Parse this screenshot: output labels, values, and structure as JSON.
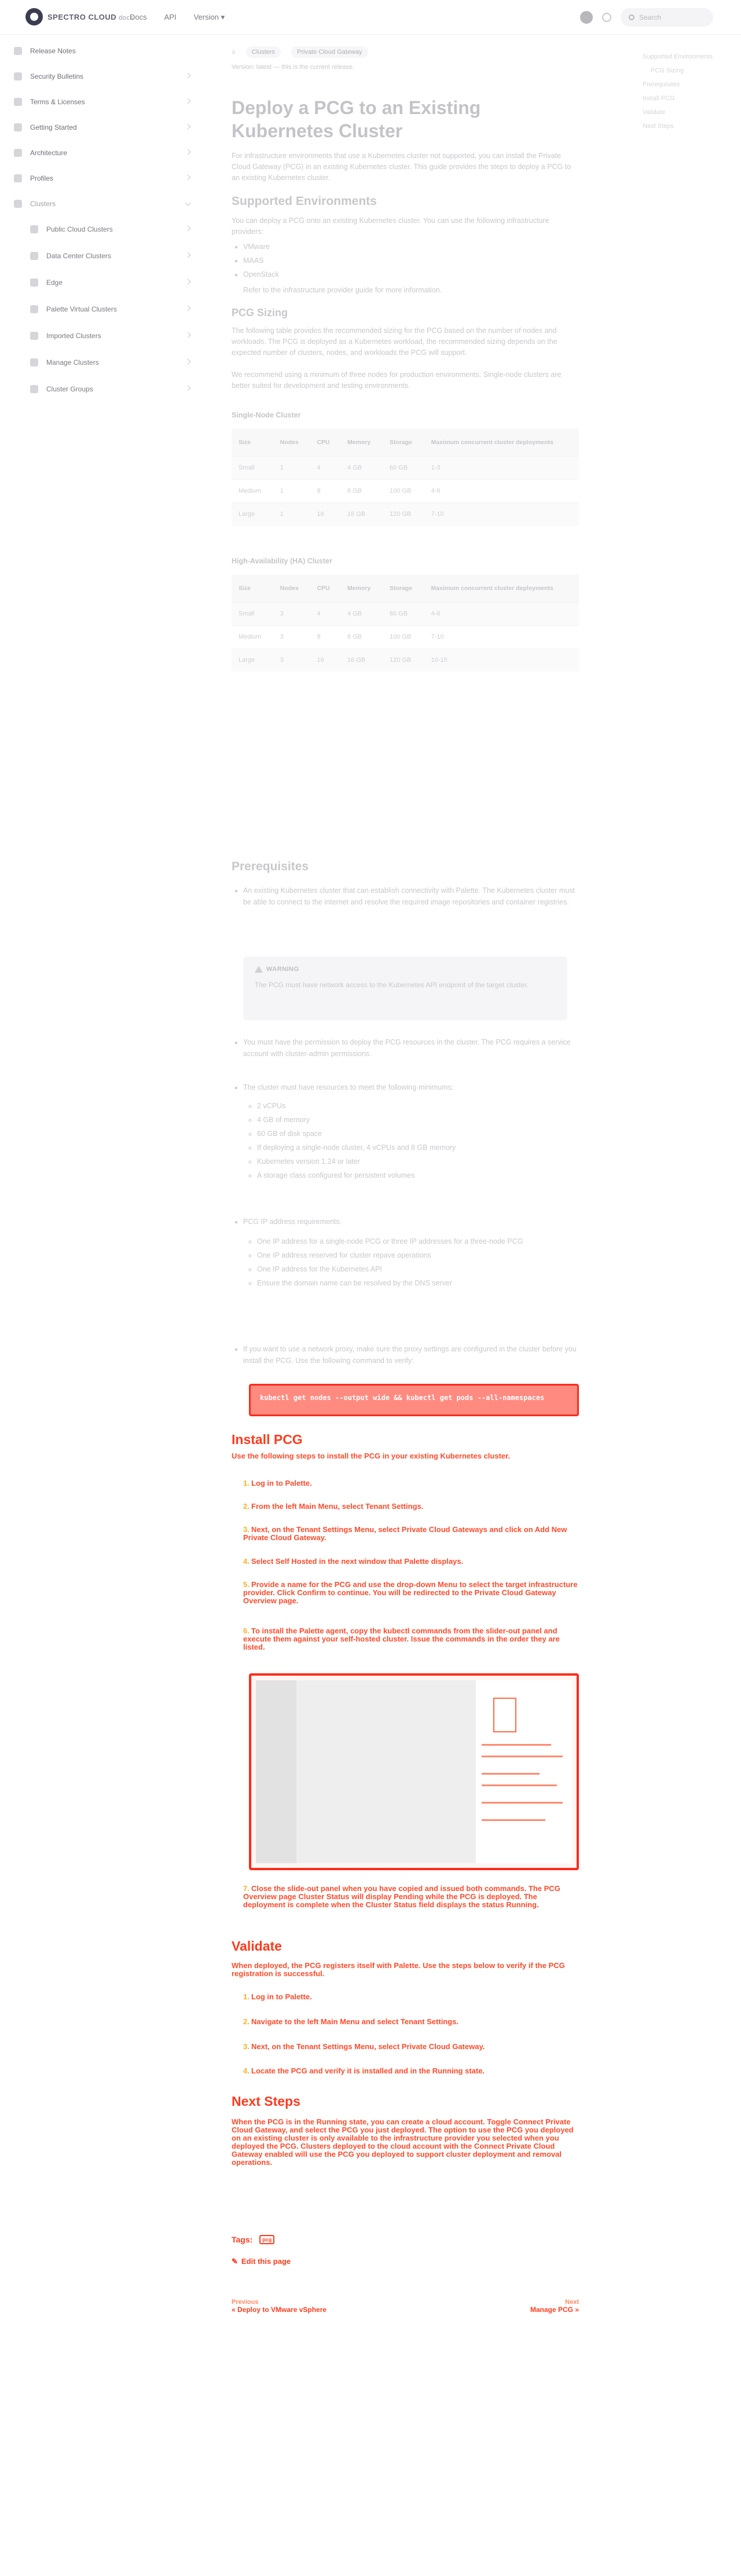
{
  "navbar": {
    "brand": "SPECTRO CLOUD",
    "brand_sub": "docs",
    "links": [
      "Docs",
      "API",
      "Version ▾"
    ],
    "search_placeholder": "Search"
  },
  "sidebar": {
    "items": [
      {
        "label": "Release Notes"
      },
      {
        "label": "Security Bulletins"
      },
      {
        "label": "Terms & Licenses"
      },
      {
        "label": "Getting Started"
      },
      {
        "label": "Architecture"
      },
      {
        "label": "Profiles"
      },
      {
        "label": "Clusters"
      },
      {
        "label": "Public Cloud Clusters"
      },
      {
        "label": "Data Center Clusters"
      },
      {
        "label": "Edge"
      },
      {
        "label": "Palette Virtual Clusters"
      },
      {
        "label": "Imported Clusters"
      },
      {
        "label": "Manage Clusters"
      },
      {
        "label": "Cluster Groups"
      }
    ]
  },
  "breadcrumb": [
    "Clusters",
    "Private Cloud Gateway"
  ],
  "page": {
    "version_note": "Version: latest — this is the current release.",
    "title": "Deploy a PCG to an Existing Kubernetes Cluster",
    "intro": "For infrastructure environments that use a Kubernetes cluster not supported, you can install the Private Cloud Gateway (PCG) in an existing Kubernetes cluster. This guide provides the steps to deploy a PCG to an existing Kubernetes cluster.",
    "supported_title": "Supported Environments",
    "supported_text": "You can deploy a PCG onto an existing Kubernetes cluster. You can use the following infrastructure providers:",
    "supported_items": [
      "VMware",
      "MAAS",
      "OpenStack"
    ],
    "supported_note": "Refer to the infrastructure provider guide for more information.",
    "sizing_title": "PCG Sizing",
    "sizing_text": "The following table provides the recommended sizing for the PCG based on the number of nodes and workloads. The PCG is deployed as a Kubernetes workload, the recommended sizing depends on the expected number of clusters, nodes, and workloads the PCG will support.",
    "sizing_text2": "We recommend using a minimum of three nodes for production environments. Single-node clusters are better suited for development and testing environments.",
    "single_title": "Single-Node Cluster",
    "ha_title": "High-Availability (HA) Cluster",
    "table_headers": [
      "Size",
      "Nodes",
      "CPU",
      "Memory",
      "Storage",
      "Maximum concurrent cluster deployments"
    ],
    "single_rows": [
      [
        "Small",
        "1",
        "4",
        "4 GB",
        "60 GB",
        "1-3"
      ],
      [
        "Medium",
        "1",
        "8",
        "8 GB",
        "100 GB",
        "4-6"
      ],
      [
        "Large",
        "1",
        "16",
        "16 GB",
        "120 GB",
        "7-10"
      ]
    ],
    "ha_rows": [
      [
        "Small",
        "3",
        "4",
        "4 GB",
        "60 GB",
        "4-6"
      ],
      [
        "Medium",
        "3",
        "8",
        "8 GB",
        "100 GB",
        "7-10"
      ],
      [
        "Large",
        "3",
        "16",
        "16 GB",
        "120 GB",
        "10-15"
      ]
    ],
    "prereq_title": "Prerequisites",
    "prereq_1": "An existing Kubernetes cluster that can establish connectivity with Palette. The Kubernetes cluster must be able to connect to the internet and resolve the required image repositories and container registries.",
    "warning_label": "WARNING",
    "warning_text": "The PCG must have network access to the Kubernetes API endpoint of the target cluster.",
    "prereq_2": "You must have the permission to deploy the PCG resources in the cluster. The PCG requires a service account with cluster-admin permissions.",
    "prereq_3": "The cluster must have resources to meet the following minimums:",
    "prereq_3_items": [
      "2 vCPUs",
      "4 GB of memory",
      "60 GB of disk space",
      "If deploying a single-node cluster, 4 vCPUs and 8 GB memory",
      "Kubernetes version 1.24 or later",
      "A storage class configured for persistent volumes"
    ],
    "prereq_4": "PCG IP address requirements:",
    "prereq_4_items": [
      "One IP address for a single-node PCG or three IP addresses for a three-node PCG",
      "One IP address reserved for cluster repave operations",
      "One IP address for the Kubernetes API",
      "Ensure the domain name can be resolved by the DNS server"
    ],
    "prereq_5": "If you want to use a network proxy, make sure the proxy settings are configured in the cluster before you install the PCG. Use the following command to verify:",
    "code": "kubectl get nodes --output wide && kubectl get pods --all-namespaces",
    "install_title": "Install PCG",
    "install_text": "Use the following steps to install the PCG in your existing Kubernetes cluster.",
    "install_steps": [
      "Log in to Palette.",
      "From the left Main Menu, select Tenant Settings.",
      "Next, on the Tenant Settings Menu, select Private Cloud Gateways and click on Add New Private Cloud Gateway.",
      "Select Self Hosted in the next window that Palette displays.",
      "Provide a name for the PCG and use the drop-down Menu to select the target infrastructure provider. Click Confirm to continue. You will be redirected to the Private Cloud Gateway Overview page.",
      "To install the Palette agent, copy the kubectl commands from the slider-out panel and execute them against your self-hosted cluster. Issue the commands in the order they are listed."
    ],
    "install_steps_after": [
      "Close the slide-out panel when you have copied and issued both commands. The PCG Overview page Cluster Status will display Pending while the PCG is deployed. The deployment is complete when the Cluster Status field displays the status Running."
    ],
    "validate_title": "Validate",
    "validate_text": "When deployed, the PCG registers itself with Palette. Use the steps below to verify if the PCG registration is successful.",
    "validate_steps": [
      "Log in to Palette.",
      "Navigate to the left Main Menu and select Tenant Settings.",
      "Next, on the Tenant Settings Menu, select Private Cloud Gateway.",
      "Locate the PCG and verify it is installed and in the Running state."
    ],
    "next_title": "Next Steps",
    "next_text": "When the PCG is in the Running state, you can create a cloud account. Toggle Connect Private Cloud Gateway, and select the PCG you just deployed. The option to use the PCG you deployed on an existing cluster is only available to the infrastructure provider you selected when you deployed the PCG. Clusters deployed to the cloud account with the Connect Private Cloud Gateway enabled will use the PCG you deployed to support cluster deployment and removal operations.",
    "tags_label": "Tags:",
    "tag": "pcg",
    "edit_label": "Edit this page",
    "prev_label": "Previous",
    "prev_title": "« Deploy to VMware vSphere",
    "next_label": "Next",
    "next_page": "Manage PCG »"
  },
  "toc": [
    "Supported Environments",
    "PCG Sizing",
    "Prerequisites",
    "Install PCG",
    "Validate",
    "Next Steps"
  ],
  "colors": {
    "highlight": "#ff3b1c",
    "faded": "#c8c8cc"
  }
}
